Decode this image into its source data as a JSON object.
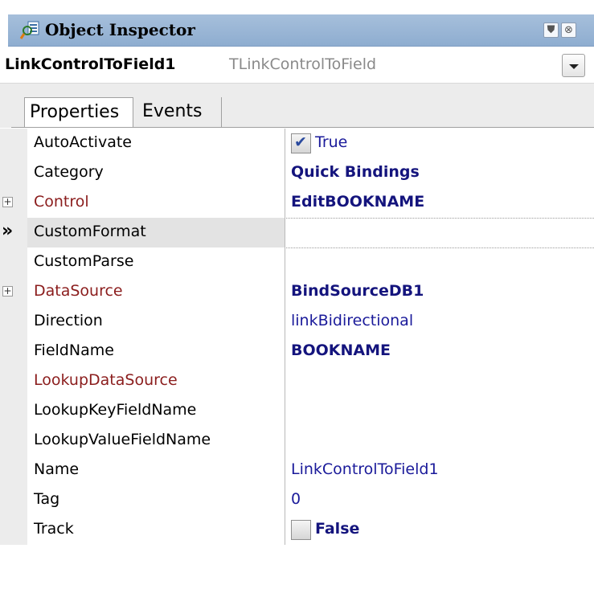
{
  "window": {
    "title": "Object Inspector",
    "title_icon": "object-inspector-icon",
    "buttons": [
      {
        "name": "pin-icon",
        "glyph": "⛊"
      },
      {
        "name": "close-icon",
        "glyph": "⊗"
      }
    ]
  },
  "object_selector": {
    "name": "LinkControlToField1",
    "type": "TLinkControlToField"
  },
  "tabs": [
    {
      "label": "Properties",
      "active": true
    },
    {
      "label": "Events",
      "active": false
    }
  ],
  "properties": [
    {
      "name": "AutoActivate",
      "value": "True",
      "kind": "checkbox",
      "checked": true,
      "bold": false,
      "ref": false,
      "expandable": false
    },
    {
      "name": "Category",
      "value": "Quick Bindings",
      "kind": "text",
      "bold": true,
      "ref": false,
      "expandable": false
    },
    {
      "name": "Control",
      "value": "EditBOOKNAME",
      "kind": "text",
      "bold": true,
      "ref": true,
      "expandable": true
    },
    {
      "name": "CustomFormat",
      "value": "",
      "kind": "text",
      "bold": false,
      "ref": false,
      "expandable": false,
      "selected": true
    },
    {
      "name": "CustomParse",
      "value": "",
      "kind": "text",
      "bold": false,
      "ref": false,
      "expandable": false
    },
    {
      "name": "DataSource",
      "value": "BindSourceDB1",
      "kind": "text",
      "bold": true,
      "ref": true,
      "expandable": true
    },
    {
      "name": "Direction",
      "value": "linkBidirectional",
      "kind": "text",
      "bold": false,
      "ref": false,
      "expandable": false
    },
    {
      "name": "FieldName",
      "value": "BOOKNAME",
      "kind": "text",
      "bold": true,
      "ref": false,
      "expandable": false
    },
    {
      "name": "LookupDataSource",
      "value": "",
      "kind": "text",
      "bold": false,
      "ref": true,
      "expandable": false
    },
    {
      "name": "LookupKeyFieldName",
      "value": "",
      "kind": "text",
      "bold": false,
      "ref": false,
      "expandable": false
    },
    {
      "name": "LookupValueFieldName",
      "value": "",
      "kind": "text",
      "bold": false,
      "ref": false,
      "expandable": false
    },
    {
      "name": "Name",
      "value": "LinkControlToField1",
      "kind": "text",
      "bold": false,
      "ref": false,
      "expandable": false
    },
    {
      "name": "Tag",
      "value": "0",
      "kind": "text",
      "bold": false,
      "ref": false,
      "expandable": false
    },
    {
      "name": "Track",
      "value": "False",
      "kind": "checkbox",
      "checked": false,
      "bold": true,
      "ref": false,
      "expandable": false
    }
  ],
  "colors": {
    "titlebar": "#9bb7d8",
    "value_text": "#1a1a9a",
    "reference_property": "#8b1d1d",
    "selected_row": "#e3e3e3"
  }
}
